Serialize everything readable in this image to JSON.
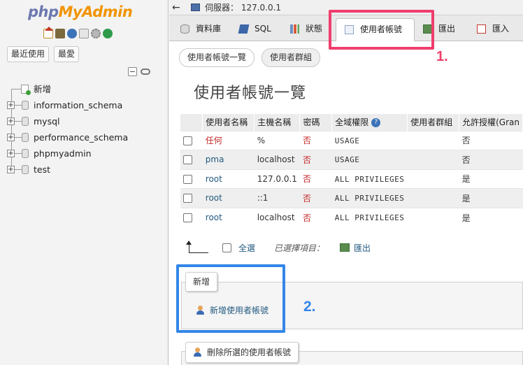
{
  "logo": {
    "php": "php",
    "myadmin": "MyAdmin"
  },
  "left_buttons": {
    "recent": "最近使用",
    "favorites": "最愛"
  },
  "tree": {
    "new_label": "新增",
    "databases": [
      "information_schema",
      "mysql",
      "performance_schema",
      "phpmyadmin",
      "test"
    ]
  },
  "topbar": {
    "back": "←",
    "server": "伺服器： 127.0.0.1"
  },
  "tabs": {
    "databases": "資料庫",
    "sql": "SQL",
    "status": "狀態",
    "users": "使用者帳號",
    "export": "匯出",
    "import": "匯入"
  },
  "subtabs": {
    "overview": "使用者帳號一覽",
    "groups": "使用者群組"
  },
  "page_title": "使用者帳號一覽",
  "table": {
    "headers": [
      "使用者名稱",
      "主機名稱",
      "密碼",
      "全域權限",
      "使用者群組",
      "允許授權(Gran"
    ],
    "rows": [
      {
        "user": "任何",
        "host": "%",
        "password": "否",
        "privileges": "USAGE",
        "group": "",
        "grant": "否"
      },
      {
        "user": "pma",
        "host": "localhost",
        "password": "否",
        "privileges": "USAGE",
        "group": "",
        "grant": "否"
      },
      {
        "user": "root",
        "host": "127.0.0.1",
        "password": "否",
        "privileges": "ALL PRIVILEGES",
        "group": "",
        "grant": "是"
      },
      {
        "user": "root",
        "host": "::1",
        "password": "否",
        "privileges": "ALL PRIVILEGES",
        "group": "",
        "grant": "是"
      },
      {
        "user": "root",
        "host": "localhost",
        "password": "否",
        "privileges": "ALL PRIVILEGES",
        "group": "",
        "grant": "是"
      }
    ]
  },
  "bulk": {
    "check_all": "全選",
    "with_selected": "已選擇項目：",
    "export": "匯出"
  },
  "add_section": {
    "legend": "新增",
    "link": "新增使用者帳號"
  },
  "delete_section": {
    "legend": "刪除所選的使用者帳號"
  },
  "annotations": {
    "one": "1.",
    "two": "2."
  },
  "colors": {
    "annotation_red": "#ef3e6d",
    "annotation_blue": "#3486e8",
    "link": "#235a81"
  }
}
